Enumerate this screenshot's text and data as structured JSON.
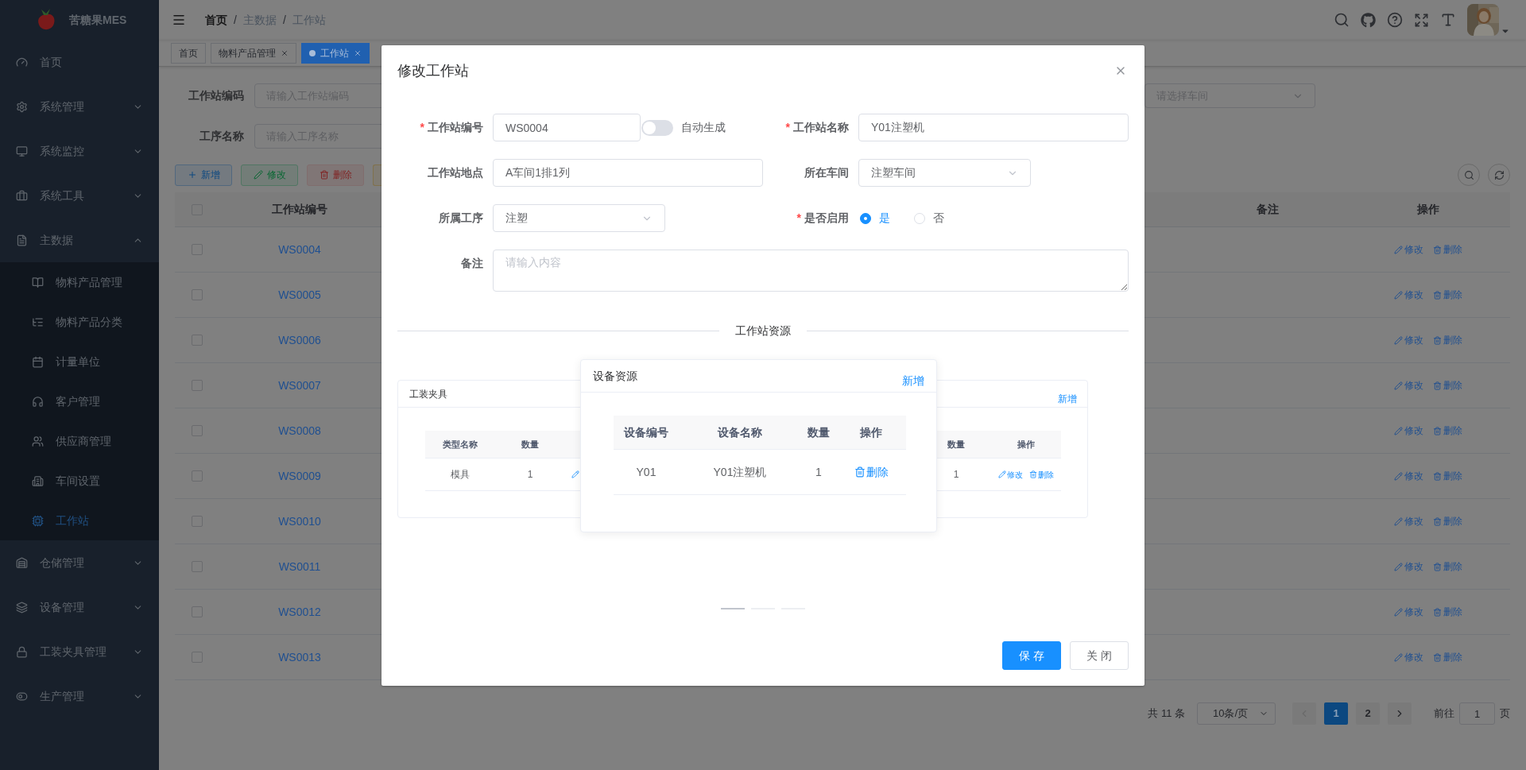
{
  "sidebar": {
    "logo": "苦糖果MES",
    "items": [
      {
        "kind": "link",
        "label": "首页"
      },
      {
        "kind": "group",
        "label": "系统管理",
        "expanded": false
      },
      {
        "kind": "group",
        "label": "系统监控",
        "expanded": false
      },
      {
        "kind": "group",
        "label": "系统工具",
        "expanded": false
      },
      {
        "kind": "group",
        "label": "主数据",
        "expanded": true,
        "children": [
          {
            "label": "物料产品管理",
            "selected": false
          },
          {
            "label": "物料产品分类",
            "selected": false
          },
          {
            "label": "计量单位",
            "selected": false
          },
          {
            "label": "客户管理",
            "selected": false
          },
          {
            "label": "供应商管理",
            "selected": false
          },
          {
            "label": "车间设置",
            "selected": false
          },
          {
            "label": "工作站",
            "selected": true
          }
        ]
      },
      {
        "kind": "group",
        "label": "仓储管理",
        "expanded": false
      },
      {
        "kind": "group",
        "label": "设备管理",
        "expanded": false
      },
      {
        "kind": "group",
        "label": "工装夹具管理",
        "expanded": false
      },
      {
        "kind": "group",
        "label": "生产管理",
        "expanded": false
      }
    ]
  },
  "breadcrumb": {
    "separator": "/",
    "items": [
      "首页",
      "主数据",
      "工作站"
    ]
  },
  "tags": [
    {
      "label": "首页",
      "selected": false,
      "closable": false
    },
    {
      "label": "物料产品管理",
      "selected": false,
      "closable": true
    },
    {
      "label": "工作站",
      "selected": true,
      "closable": true
    }
  ],
  "search": {
    "fields": [
      {
        "label": "工作站编码",
        "placeholder": "请输入工作站编码"
      },
      {
        "label": "工序名称",
        "placeholder": "请输入工序名称"
      }
    ],
    "workshop_select": {
      "placeholder": "请选择车间"
    }
  },
  "toolbar": [
    {
      "kind": "add",
      "label": "新增"
    },
    {
      "kind": "edit",
      "label": "修改"
    },
    {
      "kind": "delete",
      "label": "删除"
    },
    {
      "kind": "warning"
    }
  ],
  "table": {
    "header_checked": false,
    "columns": {
      "code": "工作站编号",
      "remark": "备注",
      "actions": "操作"
    },
    "rows": [
      {
        "code": "WS0004",
        "checked": false,
        "actions": [
          {
            "kind": "edit",
            "label": "修改"
          },
          {
            "kind": "delete",
            "label": "删除"
          }
        ]
      },
      {
        "code": "WS0005",
        "checked": false,
        "actions": [
          {
            "kind": "edit",
            "label": "修改"
          },
          {
            "kind": "delete",
            "label": "删除"
          }
        ]
      },
      {
        "code": "WS0006",
        "checked": false,
        "actions": [
          {
            "kind": "edit",
            "label": "修改"
          },
          {
            "kind": "delete",
            "label": "删除"
          }
        ]
      },
      {
        "code": "WS0007",
        "checked": false,
        "actions": [
          {
            "kind": "edit",
            "label": "修改"
          },
          {
            "kind": "delete",
            "label": "删除"
          }
        ]
      },
      {
        "code": "WS0008",
        "checked": false,
        "actions": [
          {
            "kind": "edit",
            "label": "修改"
          },
          {
            "kind": "delete",
            "label": "删除"
          }
        ]
      },
      {
        "code": "WS0009",
        "checked": false,
        "actions": [
          {
            "kind": "edit",
            "label": "修改"
          },
          {
            "kind": "delete",
            "label": "删除"
          }
        ]
      },
      {
        "code": "WS0010",
        "checked": false,
        "actions": [
          {
            "kind": "edit",
            "label": "修改"
          },
          {
            "kind": "delete",
            "label": "删除"
          }
        ]
      },
      {
        "code": "WS0011",
        "checked": false,
        "actions": [
          {
            "kind": "edit",
            "label": "修改"
          },
          {
            "kind": "delete",
            "label": "删除"
          }
        ]
      },
      {
        "code": "WS0012",
        "checked": false,
        "actions": [
          {
            "kind": "edit",
            "label": "修改"
          },
          {
            "kind": "delete",
            "label": "删除"
          }
        ]
      },
      {
        "code": "WS0013",
        "checked": false,
        "actions": [
          {
            "kind": "edit",
            "label": "修改"
          },
          {
            "kind": "delete",
            "label": "删除"
          }
        ]
      }
    ]
  },
  "pagination": {
    "total": "共 11 条",
    "page_size": "10条/页",
    "prev_disabled": true,
    "pages": [
      {
        "label": "1",
        "selected": true
      },
      {
        "label": "2",
        "selected": false
      }
    ],
    "goto_label": "前往",
    "goto_value": "1",
    "goto_suffix": "页"
  },
  "modal": {
    "title": "修改工作站",
    "form": {
      "required_mark": "*",
      "fields": [
        {
          "kind": "input",
          "label": "工作站编号",
          "required": true,
          "value": "WS0004",
          "toggle": {
            "label": "自动生成",
            "on": false
          }
        },
        {
          "kind": "input",
          "label": "工作站名称",
          "required": true,
          "value": "Y01注塑机"
        },
        {
          "kind": "input",
          "label": "工作站地点",
          "required": false,
          "value": "A车间1排1列"
        },
        {
          "kind": "select",
          "label": "所在车间",
          "required": false,
          "value": "注塑车间"
        },
        {
          "kind": "select",
          "label": "所属工序",
          "required": false,
          "value": "注塑"
        },
        {
          "kind": "radio",
          "label": "是否启用",
          "required": true,
          "options": [
            {
              "label": "是",
              "selected": true
            },
            {
              "label": "否",
              "selected": false
            }
          ]
        },
        {
          "kind": "textarea",
          "label": "备注",
          "required": false,
          "placeholder": "请输入内容"
        }
      ]
    },
    "section_title": "工作站资源",
    "cards": [
      {
        "title": "工装夹具",
        "columns": [
          "类型名称",
          "数量"
        ],
        "rows": [
          {
            "cells": [
              "模具",
              "1"
            ],
            "actions": [
              {
                "kind": "edit"
              }
            ]
          }
        ]
      },
      {
        "title": "设备资源",
        "add": "新增",
        "columns": [
          "设备编号",
          "设备名称",
          "数量",
          "操作"
        ],
        "rows": [
          {
            "cells": [
              "Y01",
              "Y01注塑机",
              "1"
            ],
            "actions": [
              {
                "kind": "delete",
                "label": "删除"
              }
            ]
          }
        ]
      },
      {
        "add": "新增",
        "columns": [
          "数量",
          "操作"
        ],
        "rows": [
          {
            "cells": [
              "1"
            ],
            "actions": [
              {
                "kind": "edit",
                "label": "修改"
              },
              {
                "kind": "delete",
                "label": "删除"
              }
            ]
          }
        ]
      }
    ],
    "indicators": [
      {
        "selected": true
      },
      {
        "selected": false
      },
      {
        "selected": false
      }
    ],
    "buttons": [
      {
        "kind": "primary",
        "label": "保 存"
      },
      {
        "kind": "default",
        "label": "关 闭"
      }
    ]
  }
}
